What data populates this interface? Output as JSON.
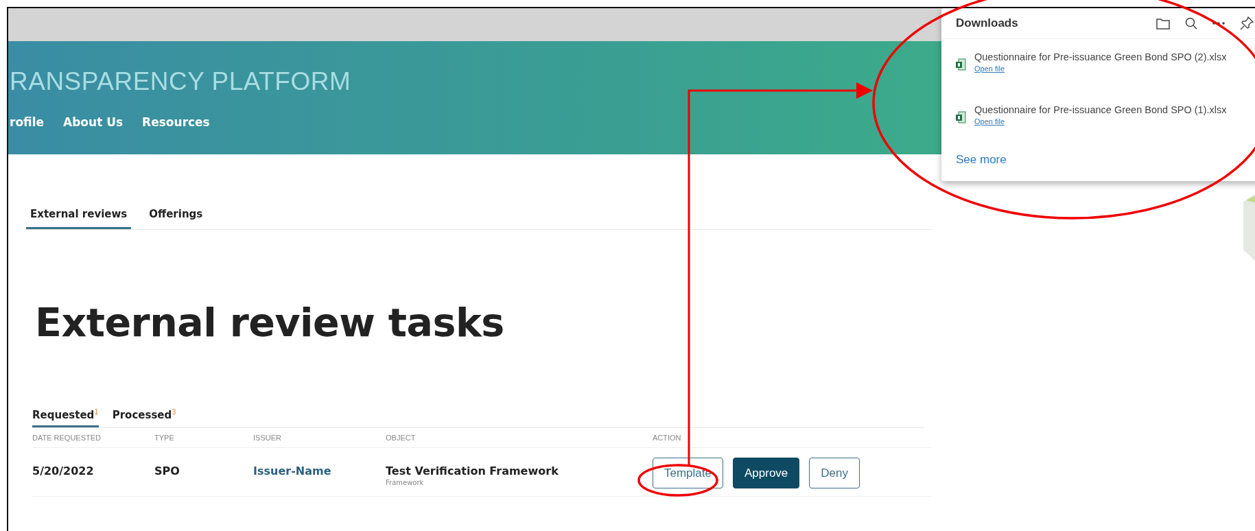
{
  "header": {
    "title": "RANSPARENCY PLATFORM",
    "nav": [
      "rofile",
      "About Us",
      "Resources"
    ]
  },
  "tabs": [
    {
      "label": "External reviews",
      "selected": true
    },
    {
      "label": "Offerings",
      "selected": false
    }
  ],
  "heading": "External review tasks",
  "subtabs": [
    {
      "label": "Requested",
      "count": "1",
      "selected": true
    },
    {
      "label": "Processed",
      "count": "3",
      "selected": false
    }
  ],
  "table": {
    "columns": [
      "DATE REQUESTED",
      "TYPE",
      "ISSUER",
      "OBJECT",
      "ACTION"
    ],
    "rows": [
      {
        "date": "5/20/2022",
        "type": "SPO",
        "issuer": "Issuer-Name",
        "object": "Test Verification Framework",
        "object_type": "Framework",
        "actions": [
          {
            "label": "Template",
            "kind": "outline"
          },
          {
            "label": "Approve",
            "kind": "filled"
          },
          {
            "label": "Deny",
            "kind": "outline"
          }
        ]
      }
    ]
  },
  "downloads": {
    "title": "Downloads",
    "items": [
      {
        "name": "Questionnaire for Pre-issuance Green Bond SPO (2).xlsx",
        "link": "Open file"
      },
      {
        "name": "Questionnaire for Pre-issuance Green Bond SPO (1).xlsx",
        "link": "Open file"
      }
    ],
    "more": "See more"
  }
}
